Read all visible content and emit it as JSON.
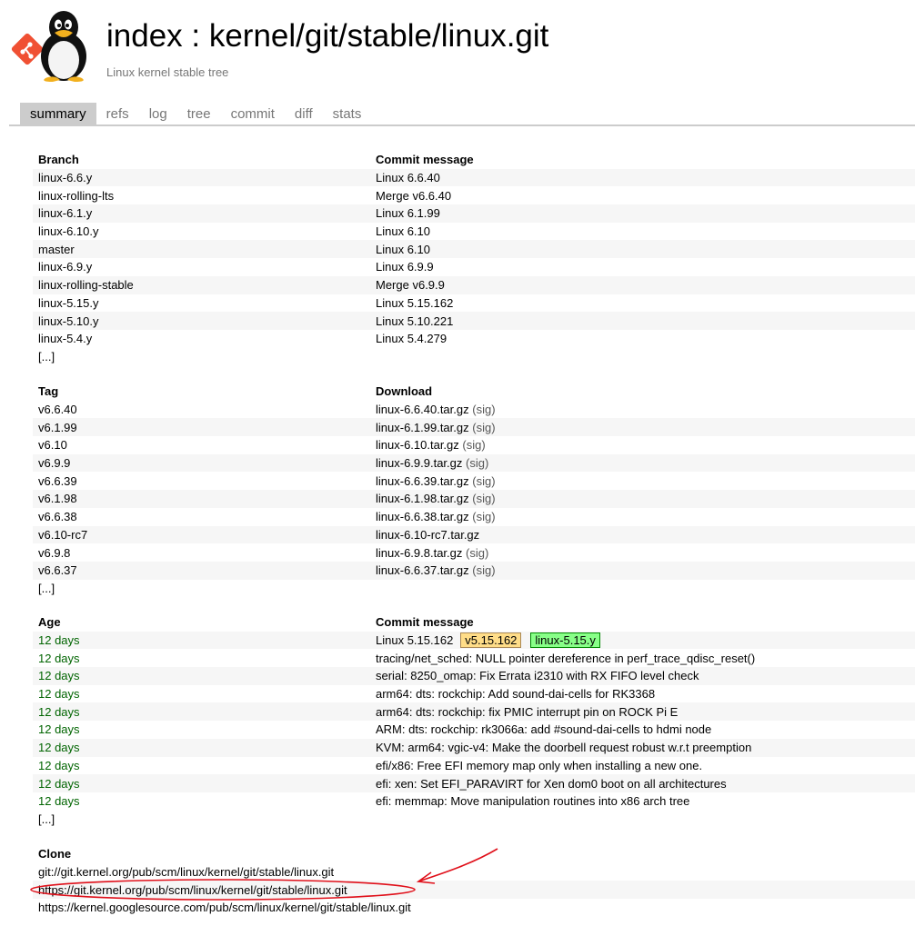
{
  "header": {
    "title": "index : kernel/git/stable/linux.git",
    "subtitle": "Linux kernel stable tree"
  },
  "tabs": [
    {
      "label": "summary",
      "active": true
    },
    {
      "label": "refs"
    },
    {
      "label": "log"
    },
    {
      "label": "tree"
    },
    {
      "label": "commit"
    },
    {
      "label": "diff"
    },
    {
      "label": "stats"
    }
  ],
  "branches": {
    "header_left": "Branch",
    "header_right": "Commit message",
    "rows": [
      {
        "name": "linux-6.6.y",
        "msg": "Linux 6.6.40"
      },
      {
        "name": "linux-rolling-lts",
        "msg": "Merge v6.6.40"
      },
      {
        "name": "linux-6.1.y",
        "msg": "Linux 6.1.99"
      },
      {
        "name": "linux-6.10.y",
        "msg": "Linux 6.10"
      },
      {
        "name": "master",
        "msg": "Linux 6.10"
      },
      {
        "name": "linux-6.9.y",
        "msg": "Linux 6.9.9"
      },
      {
        "name": "linux-rolling-stable",
        "msg": "Merge v6.9.9"
      },
      {
        "name": "linux-5.15.y",
        "msg": "Linux 5.15.162"
      },
      {
        "name": "linux-5.10.y",
        "msg": "Linux 5.10.221"
      },
      {
        "name": "linux-5.4.y",
        "msg": "Linux 5.4.279"
      }
    ],
    "more": "[...]"
  },
  "tags": {
    "header_left": "Tag",
    "header_right": "Download",
    "rows": [
      {
        "name": "v6.6.40",
        "file": "linux-6.6.40.tar.gz",
        "sig": "(sig)"
      },
      {
        "name": "v6.1.99",
        "file": "linux-6.1.99.tar.gz",
        "sig": "(sig)"
      },
      {
        "name": "v6.10",
        "file": "linux-6.10.tar.gz",
        "sig": "(sig)"
      },
      {
        "name": "v6.9.9",
        "file": "linux-6.9.9.tar.gz",
        "sig": "(sig)"
      },
      {
        "name": "v6.6.39",
        "file": "linux-6.6.39.tar.gz",
        "sig": "(sig)"
      },
      {
        "name": "v6.1.98",
        "file": "linux-6.1.98.tar.gz",
        "sig": "(sig)"
      },
      {
        "name": "v6.6.38",
        "file": "linux-6.6.38.tar.gz",
        "sig": "(sig)"
      },
      {
        "name": "v6.10-rc7",
        "file": "linux-6.10-rc7.tar.gz",
        "sig": ""
      },
      {
        "name": "v6.9.8",
        "file": "linux-6.9.8.tar.gz",
        "sig": "(sig)"
      },
      {
        "name": "v6.6.37",
        "file": "linux-6.6.37.tar.gz",
        "sig": "(sig)"
      }
    ],
    "more": "[...]"
  },
  "log": {
    "header_left": "Age",
    "header_right": "Commit message",
    "rows": [
      {
        "age": "12 days",
        "msg": "Linux 5.15.162",
        "tag_badge": "v5.15.162",
        "head_badge": "linux-5.15.y"
      },
      {
        "age": "12 days",
        "msg": "tracing/net_sched: NULL pointer dereference in perf_trace_qdisc_reset()"
      },
      {
        "age": "12 days",
        "msg": "serial: 8250_omap: Fix Errata i2310 with RX FIFO level check"
      },
      {
        "age": "12 days",
        "msg": "arm64: dts: rockchip: Add sound-dai-cells for RK3368"
      },
      {
        "age": "12 days",
        "msg": "arm64: dts: rockchip: fix PMIC interrupt pin on ROCK Pi E"
      },
      {
        "age": "12 days",
        "msg": "ARM: dts: rockchip: rk3066a: add #sound-dai-cells to hdmi node"
      },
      {
        "age": "12 days",
        "msg": "KVM: arm64: vgic-v4: Make the doorbell request robust w.r.t preemption"
      },
      {
        "age": "12 days",
        "msg": "efi/x86: Free EFI memory map only when installing a new one."
      },
      {
        "age": "12 days",
        "msg": "efi: xen: Set EFI_PARAVIRT for Xen dom0 boot on all architectures"
      },
      {
        "age": "12 days",
        "msg": "efi: memmap: Move manipulation routines into x86 arch tree"
      }
    ],
    "more": "[...]"
  },
  "clone": {
    "header": "Clone",
    "urls": [
      "git://git.kernel.org/pub/scm/linux/kernel/git/stable/linux.git",
      "https://git.kernel.org/pub/scm/linux/kernel/git/stable/linux.git",
      "https://kernel.googlesource.com/pub/scm/linux/kernel/git/stable/linux.git"
    ]
  },
  "colors": {
    "age_green": "#006400",
    "tab_active_bg": "#cccccc",
    "tag_badge_bg": "#ffdd88",
    "head_badge_bg": "#88ff88",
    "annotation_red": "#e0101a",
    "git_logo_red": "#f05033"
  },
  "icons": {
    "logo": "tux-penguin-with-git-icon",
    "annotation": "red-hand-drawn-ellipse-and-arrow"
  }
}
